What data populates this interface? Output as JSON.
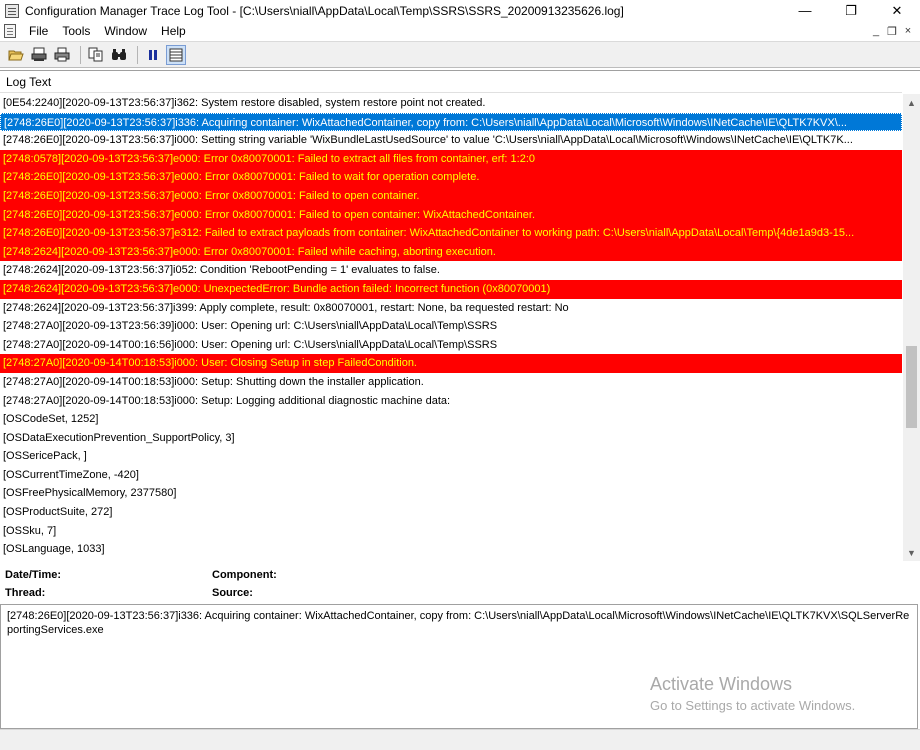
{
  "window": {
    "title": "Configuration Manager Trace Log Tool - [C:\\Users\\niall\\AppData\\Local\\Temp\\SSRS\\SSRS_20200913235626.log]",
    "minimize_glyph": "—",
    "maximize_glyph": "❐",
    "close_glyph": "✕"
  },
  "menu": {
    "items": [
      "File",
      "Tools",
      "Window",
      "Help"
    ],
    "mdi_min": "_",
    "mdi_restore": "❐",
    "mdi_close": "×"
  },
  "toolbar": {
    "buttons": [
      "open-folder-icon",
      "print-preview-icon",
      "print-icon",
      "copy-icon",
      "find-icon",
      "pause-icon",
      "layout-icon"
    ]
  },
  "log": {
    "header": "Log Text",
    "rows": [
      {
        "text": "[0E54:2240][2020-09-13T23:56:37]i362: System restore disabled, system restore point not created.",
        "type": "normal"
      },
      {
        "text": "[2748:26E0][2020-09-13T23:56:37]i336: Acquiring container: WixAttachedContainer, copy from: C:\\Users\\niall\\AppData\\Local\\Microsoft\\Windows\\INetCache\\IE\\QLTK7KVX\\...",
        "type": "selected"
      },
      {
        "text": "[2748:26E0][2020-09-13T23:56:37]i000: Setting string variable 'WixBundleLastUsedSource' to value 'C:\\Users\\niall\\AppData\\Local\\Microsoft\\Windows\\INetCache\\IE\\QLTK7K...",
        "type": "normal"
      },
      {
        "text": "[2748:0578][2020-09-13T23:56:37]e000: Error 0x80070001: Failed to extract all files from container, erf: 1:2:0",
        "type": "error"
      },
      {
        "text": "[2748:26E0][2020-09-13T23:56:37]e000: Error 0x80070001: Failed to wait for operation complete.",
        "type": "error"
      },
      {
        "text": "[2748:26E0][2020-09-13T23:56:37]e000: Error 0x80070001: Failed to open container.",
        "type": "error"
      },
      {
        "text": "[2748:26E0][2020-09-13T23:56:37]e000: Error 0x80070001: Failed to open container: WixAttachedContainer.",
        "type": "error"
      },
      {
        "text": "[2748:26E0][2020-09-13T23:56:37]e312: Failed to extract payloads from container: WixAttachedContainer to working path: C:\\Users\\niall\\AppData\\Local\\Temp\\{4de1a9d3-15...",
        "type": "error"
      },
      {
        "text": "[2748:2624][2020-09-13T23:56:37]e000: Error 0x80070001: Failed while caching, aborting execution.",
        "type": "error"
      },
      {
        "text": "[2748:2624][2020-09-13T23:56:37]i052: Condition 'RebootPending = 1' evaluates to false.",
        "type": "normal"
      },
      {
        "text": "[2748:2624][2020-09-13T23:56:37]e000: UnexpectedError: Bundle action failed: Incorrect function (0x80070001)",
        "type": "error"
      },
      {
        "text": "[2748:2624][2020-09-13T23:56:37]i399: Apply complete, result: 0x80070001, restart: None, ba requested restart:  No",
        "type": "normal"
      },
      {
        "text": "[2748:27A0][2020-09-13T23:56:39]i000: User: Opening url: C:\\Users\\niall\\AppData\\Local\\Temp\\SSRS",
        "type": "normal"
      },
      {
        "text": "[2748:27A0][2020-09-14T00:16:56]i000: User: Opening url: C:\\Users\\niall\\AppData\\Local\\Temp\\SSRS",
        "type": "normal"
      },
      {
        "text": "[2748:27A0][2020-09-14T00:18:53]i000: User: Closing Setup in step FailedCondition.",
        "type": "error"
      },
      {
        "text": "[2748:27A0][2020-09-14T00:18:53]i000: Setup: Shutting down the installer application.",
        "type": "normal"
      },
      {
        "text": "[2748:27A0][2020-09-14T00:18:53]i000: Setup: Logging additional diagnostic machine data:",
        "type": "normal"
      },
      {
        "text": "[OSCodeSet, 1252]",
        "type": "normal"
      },
      {
        "text": "[OSDataExecutionPrevention_SupportPolicy, 3]",
        "type": "normal"
      },
      {
        "text": "[OSSericePack, ]",
        "type": "normal"
      },
      {
        "text": "[OSCurrentTimeZone, -420]",
        "type": "normal"
      },
      {
        "text": "[OSFreePhysicalMemory, 2377580]",
        "type": "normal"
      },
      {
        "text": "[OSProductSuite, 272]",
        "type": "normal"
      },
      {
        "text": "[OSSku, 7]",
        "type": "normal"
      },
      {
        "text": "[OSLanguage, 1033]",
        "type": "normal"
      }
    ],
    "scroll_up": "▲",
    "scroll_down": "▼"
  },
  "details": {
    "datetime_label": "Date/Time:",
    "component_label": "Component:",
    "thread_label": "Thread:",
    "source_label": "Source:",
    "text": "[2748:26E0][2020-09-13T23:56:37]i336: Acquiring container: WixAttachedContainer, copy from: C:\\Users\\niall\\AppData\\Local\\Microsoft\\Windows\\INetCache\\IE\\QLTK7KVX\\SQLServerReportingServices.exe"
  },
  "watermark": {
    "title": "Activate Windows",
    "subtitle": "Go to Settings to activate Windows."
  },
  "colors": {
    "error_bg": "#ff0000",
    "error_fg": "#ffff00",
    "selected_bg": "#0078d7"
  }
}
